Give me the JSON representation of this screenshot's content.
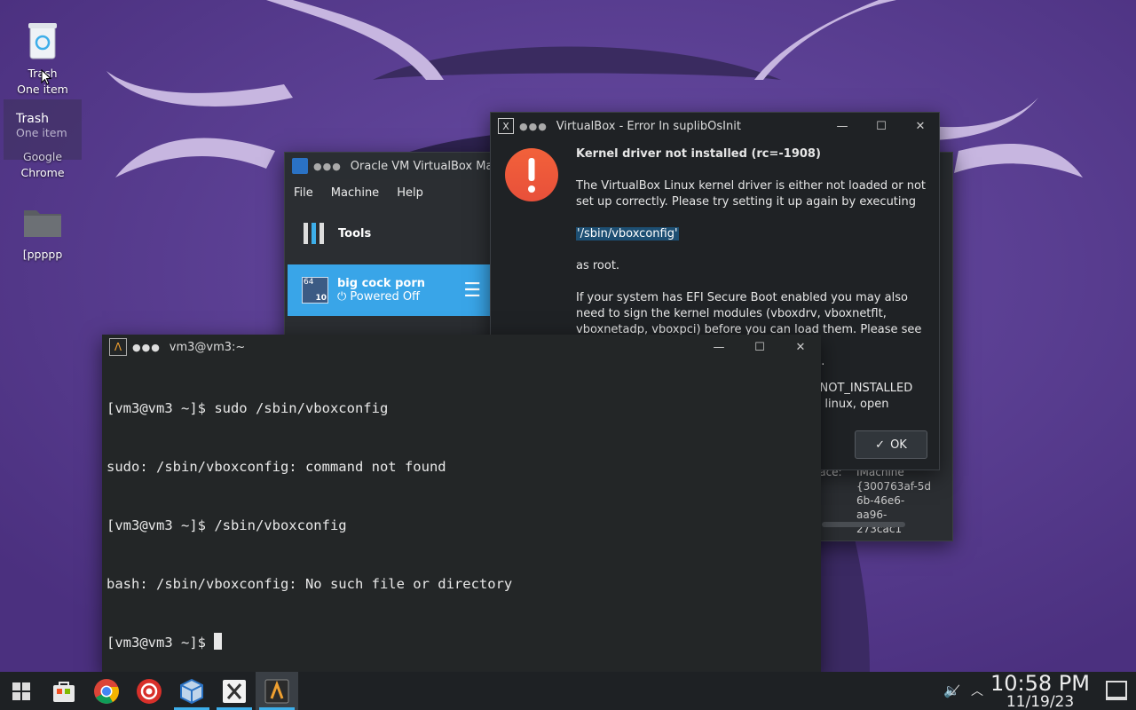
{
  "desktop": {
    "icons": [
      {
        "label": "Trash",
        "sub": "One item"
      },
      {
        "label": "Google",
        "sub": "Chrome"
      },
      {
        "label": "[ppppp"
      }
    ],
    "drag_ghost": {
      "label": "Trash",
      "sub": "One item"
    }
  },
  "vbox_manager": {
    "title": "Oracle VM VirtualBox Ma",
    "menu": [
      "File",
      "Machine",
      "Help"
    ],
    "tools_label": "Tools",
    "vm": {
      "name": "big cock porn",
      "state": "Powered Off",
      "badge_top": "64",
      "badge_bottom": "10"
    },
    "details": {
      "label": "face:",
      "value_lines": [
        "IMachine",
        "{300763af-5d",
        "6b-46e6-",
        "aa96-273cac1"
      ]
    }
  },
  "error_dialog": {
    "title": "VirtualBox - Error In suplibOsInit",
    "heading": "Kernel driver not installed (rc=-1908)",
    "para1": "The VirtualBox Linux kernel driver is either not loaded or not set up correctly. Please try setting it up again by executing",
    "command": "'/sbin/vboxconfig'",
    "para2": "as root.",
    "para3": "If your system has EFI Secure Boot enabled you may also need to sign the kernel modules (vboxdrv, vboxnetflt, vboxnetadp, vboxpci) before you can load them. Please see your Linux",
    "para3_tail": "n.",
    "para4_lines": [
      "_NOT_INSTALLED",
      "n linux, open"
    ],
    "ok_label": "OK"
  },
  "terminal": {
    "title": "vm3@vm3:~",
    "lines": [
      "[vm3@vm3 ~]$ sudo /sbin/vboxconfig",
      "sudo: /sbin/vboxconfig: command not found",
      "[vm3@vm3 ~]$ /sbin/vboxconfig",
      "bash: /sbin/vboxconfig: No such file or directory"
    ],
    "prompt": "[vm3@vm3 ~]$ "
  },
  "taskbar": {
    "time": "10:58 PM",
    "date": "11/19/23"
  },
  "colors": {
    "accent": "#3daee9",
    "selection": "#39a5e8",
    "error": "#f2613a"
  }
}
